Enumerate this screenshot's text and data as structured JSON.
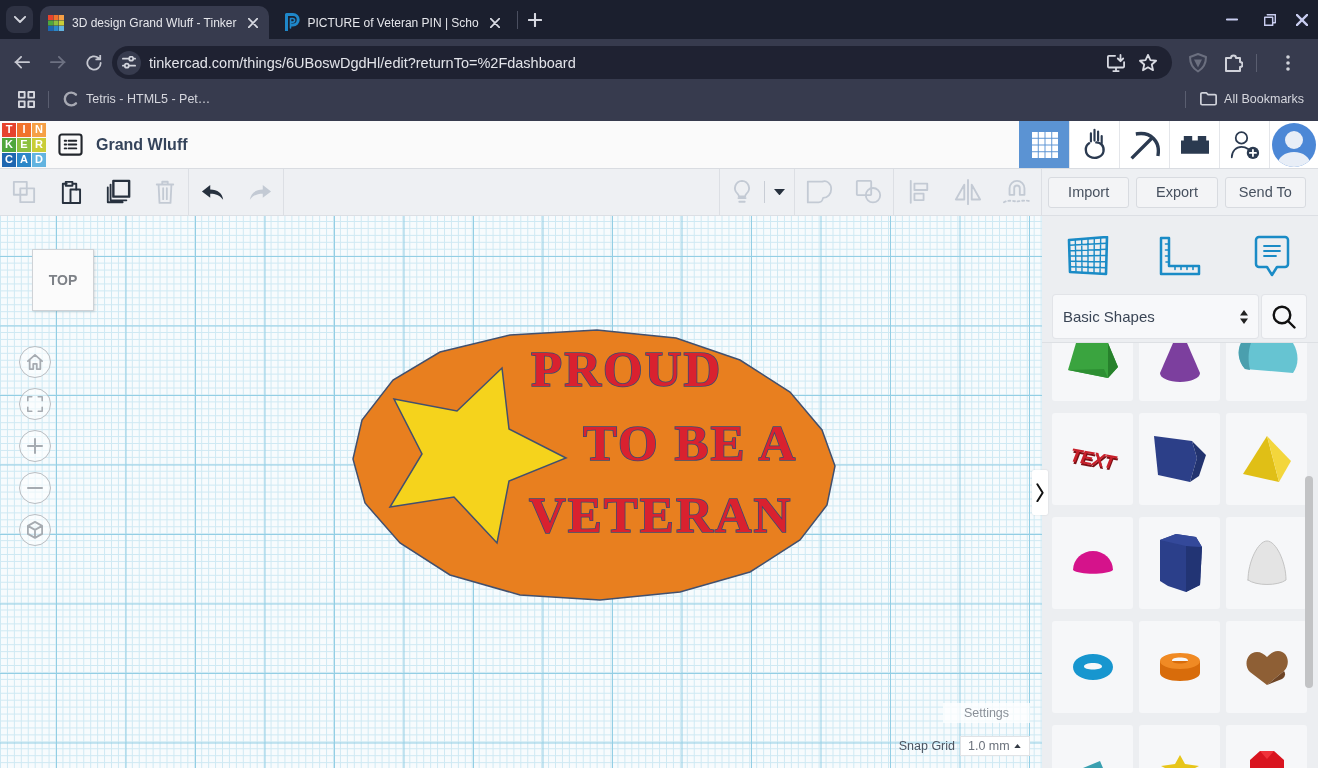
{
  "browser": {
    "tabs": [
      {
        "kind": "squares",
        "title": "3D design Grand Wluff - Tinker",
        "selected": true
      },
      {
        "kind": "p-logo",
        "title": "PICTURE of Veteran PIN | Scho",
        "selected": false
      }
    ],
    "nav": [
      {
        "kind": "back",
        "disabled": false
      },
      {
        "kind": "forward",
        "disabled": true
      },
      {
        "kind": "reload",
        "disabled": false
      }
    ],
    "address": "tinkercad.com/things/6UBoswDgdHl/edit?returnTo=%2Fdashboard",
    "bookmarks": [
      "Tetris - HTML5 - Pet…"
    ],
    "all_bookmarks": "All Bookmarks"
  },
  "app": {
    "logo": [
      {
        "letter": "T",
        "color": "#e6432d"
      },
      {
        "letter": "I",
        "color": "#f1722c"
      },
      {
        "letter": "N",
        "color": "#f6a045"
      },
      {
        "letter": "K",
        "color": "#4fa63b"
      },
      {
        "letter": "E",
        "color": "#8cc03f"
      },
      {
        "letter": "R",
        "color": "#c9cd37"
      },
      {
        "letter": "C",
        "color": "#1d66b0"
      },
      {
        "letter": "A",
        "color": "#2b87c8"
      },
      {
        "letter": "D",
        "color": "#63b4e0"
      }
    ],
    "title": "Grand Wluff",
    "views": [
      {
        "kind": "design",
        "selected": true
      },
      {
        "kind": "sim",
        "selected": false
      },
      {
        "kind": "pickaxe",
        "selected": false
      },
      {
        "kind": "bricks",
        "selected": false
      }
    ]
  },
  "toolbar": {
    "edit_groups": [
      [
        {
          "kind": "copy",
          "disabled": true
        },
        {
          "kind": "paste",
          "disabled": false
        },
        {
          "kind": "duplicate",
          "disabled": false
        },
        {
          "kind": "delete",
          "disabled": true
        }
      ],
      [
        {
          "kind": "undo",
          "disabled": false
        },
        {
          "kind": "redo",
          "disabled": true
        }
      ]
    ],
    "shape_groups": [
      [
        {
          "kind": "note",
          "disabled": true
        },
        {
          "kind": "dropdown",
          "disabled": false
        }
      ],
      [
        {
          "kind": "group",
          "disabled": true
        },
        {
          "kind": "ungroup",
          "disabled": true
        }
      ],
      [
        {
          "kind": "align",
          "disabled": true
        },
        {
          "kind": "mirror",
          "disabled": true
        },
        {
          "kind": "cruise",
          "disabled": true
        }
      ]
    ],
    "actions": [
      "Import",
      "Export",
      "Send To"
    ]
  },
  "canvas": {
    "view_cube": "TOP",
    "controls": [
      {
        "kind": "home"
      },
      {
        "kind": "fit"
      },
      {
        "kind": "zoom-in"
      },
      {
        "kind": "zoom-out"
      },
      {
        "kind": "perspective"
      }
    ],
    "design": {
      "lines": [
        "PROUD",
        "TO BE A",
        "VETERAN"
      ]
    },
    "settings": "Settings",
    "snap_grid": {
      "label": "Snap Grid",
      "value": "1.0 mm"
    }
  },
  "panel": {
    "tools": [
      {
        "kind": "workplane"
      },
      {
        "kind": "ruler"
      },
      {
        "kind": "notes"
      }
    ],
    "library": "Basic Shapes",
    "shapes": [
      {
        "kind": "roof"
      },
      {
        "kind": "cone"
      },
      {
        "kind": "round-roof"
      },
      {
        "kind": "text",
        "label": "TEXT"
      },
      {
        "kind": "polygon"
      },
      {
        "kind": "pyramid"
      },
      {
        "kind": "half-sphere"
      },
      {
        "kind": "hexagonal-prism"
      },
      {
        "kind": "paraboloid"
      },
      {
        "kind": "torus"
      },
      {
        "kind": "tube"
      },
      {
        "kind": "heart"
      },
      {
        "kind": "wedge"
      },
      {
        "kind": "star"
      },
      {
        "kind": "gem"
      }
    ]
  }
}
